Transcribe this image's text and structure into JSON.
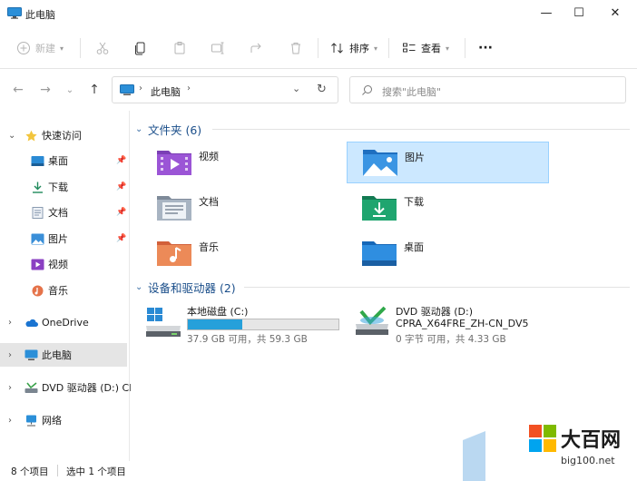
{
  "window": {
    "title": "此电脑",
    "controls": {
      "minimize": "—",
      "maximize": "☐",
      "close": "✕"
    }
  },
  "toolbar": {
    "new_label": "新建",
    "sort_label": "排序",
    "view_label": "查看",
    "more_label": "···"
  },
  "address": {
    "path": "此电脑",
    "search_placeholder": "搜索\"此电脑\""
  },
  "sidebar": {
    "items": [
      {
        "label": "快速访问",
        "icon": "star-icon"
      },
      {
        "label": "桌面",
        "icon": "desktop-icon"
      },
      {
        "label": "下载",
        "icon": "download-icon"
      },
      {
        "label": "文档",
        "icon": "document-icon"
      },
      {
        "label": "图片",
        "icon": "picture-icon"
      },
      {
        "label": "视频",
        "icon": "video-icon"
      },
      {
        "label": "音乐",
        "icon": "music-icon"
      },
      {
        "label": "OneDrive",
        "icon": "cloud-icon"
      },
      {
        "label": "此电脑",
        "icon": "computer-icon"
      },
      {
        "label": "DVD 驱动器 (D:) CF",
        "icon": "dvd-icon"
      },
      {
        "label": "网络",
        "icon": "network-icon"
      }
    ]
  },
  "folders_group": {
    "title": "文件夹 (6)",
    "items": [
      {
        "label": "视频",
        "icon": "video-folder-icon"
      },
      {
        "label": "图片",
        "icon": "pictures-folder-icon"
      },
      {
        "label": "文档",
        "icon": "documents-folder-icon"
      },
      {
        "label": "下载",
        "icon": "downloads-folder-icon"
      },
      {
        "label": "音乐",
        "icon": "music-folder-icon"
      },
      {
        "label": "桌面",
        "icon": "desktop-folder-icon"
      }
    ]
  },
  "devices_group": {
    "title": "设备和驱动器 (2)",
    "drives": [
      {
        "name": "本地磁盘 (C:)",
        "info": "37.9 GB 可用，共 59.3 GB",
        "used_fraction": 0.36,
        "icon": "local-disk-icon"
      },
      {
        "name": "DVD 驱动器 (D:)",
        "sub": "CPRA_X64FRE_ZH-CN_DV5",
        "info": "0 字节 可用，共 4.33 GB",
        "icon": "dvd-drive-icon"
      }
    ]
  },
  "status": {
    "count": "8 个项目",
    "selected": "选中 1 个项目"
  },
  "watermark": {
    "brand": "大百网",
    "url": "big100.net"
  },
  "colors": {
    "accent": "#26a0da",
    "selection": "#cce8ff",
    "group_title": "#1a4e8a"
  }
}
